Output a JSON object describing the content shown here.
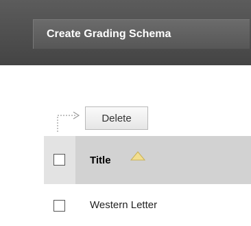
{
  "header": {
    "create_button_label": "Create Grading Schema"
  },
  "actions": {
    "delete_label": "Delete"
  },
  "table": {
    "columns": [
      {
        "label": "Title",
        "sort": "ascending"
      }
    ],
    "rows": [
      {
        "title": "Western Letter"
      }
    ]
  },
  "colors": {
    "header_bg": "#4f4f4f",
    "table_header_bg": "#d2d2d2",
    "sort_icon": "#f2de8f"
  }
}
